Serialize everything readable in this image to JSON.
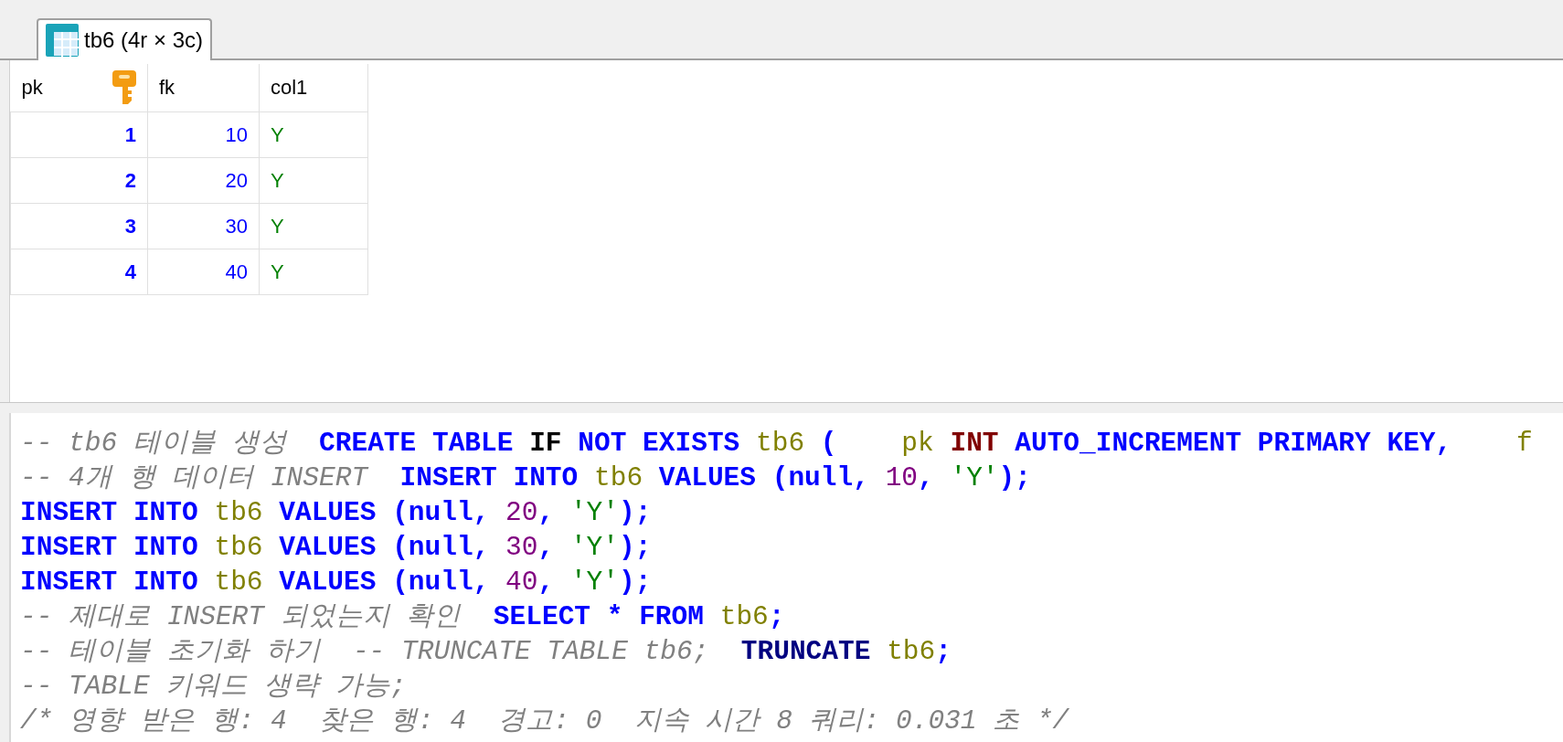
{
  "tabs": [
    {
      "label": "tb6 (4r × 3c)",
      "selected": true
    }
  ],
  "grid": {
    "columns": [
      {
        "name": "pk",
        "primary_key": true
      },
      {
        "name": "fk",
        "primary_key": false
      },
      {
        "name": "col1",
        "primary_key": false
      }
    ],
    "rows": [
      [
        "1",
        "10",
        "Y"
      ],
      [
        "2",
        "20",
        "Y"
      ],
      [
        "3",
        "30",
        "Y"
      ],
      [
        "4",
        "40",
        "Y"
      ]
    ]
  },
  "editor": {
    "lines": [
      [
        {
          "text": "-- tb6 테이블 생성  ",
          "kind": "comment"
        },
        {
          "text": "CREATE TABLE ",
          "kind": "keyword"
        },
        {
          "text": "IF",
          "kind": "plain"
        },
        {
          "text": " NOT EXISTS ",
          "kind": "keyword"
        },
        {
          "text": "tb6",
          "kind": "identifier"
        },
        {
          "text": " (    ",
          "kind": "keyword"
        },
        {
          "text": "pk ",
          "kind": "identifier"
        },
        {
          "text": "INT",
          "kind": "type"
        },
        {
          "text": " AUTO_INCREMENT PRIMARY KEY,    ",
          "kind": "keyword"
        },
        {
          "text": "f",
          "kind": "identifier"
        }
      ],
      [
        {
          "text": "-- 4개 행 데이터 INSERT  ",
          "kind": "comment"
        },
        {
          "text": "INSERT INTO ",
          "kind": "keyword"
        },
        {
          "text": "tb6",
          "kind": "identifier"
        },
        {
          "text": " VALUES (null, ",
          "kind": "keyword"
        },
        {
          "text": "10",
          "kind": "number"
        },
        {
          "text": ", ",
          "kind": "keyword"
        },
        {
          "text": "'Y'",
          "kind": "string"
        },
        {
          "text": ");",
          "kind": "keyword"
        }
      ],
      [
        {
          "text": "INSERT INTO ",
          "kind": "keyword"
        },
        {
          "text": "tb6",
          "kind": "identifier"
        },
        {
          "text": " VALUES (null, ",
          "kind": "keyword"
        },
        {
          "text": "20",
          "kind": "number"
        },
        {
          "text": ", ",
          "kind": "keyword"
        },
        {
          "text": "'Y'",
          "kind": "string"
        },
        {
          "text": ");",
          "kind": "keyword"
        }
      ],
      [
        {
          "text": "INSERT INTO ",
          "kind": "keyword"
        },
        {
          "text": "tb6",
          "kind": "identifier"
        },
        {
          "text": " VALUES (null, ",
          "kind": "keyword"
        },
        {
          "text": "30",
          "kind": "number"
        },
        {
          "text": ", ",
          "kind": "keyword"
        },
        {
          "text": "'Y'",
          "kind": "string"
        },
        {
          "text": ");",
          "kind": "keyword"
        }
      ],
      [
        {
          "text": "INSERT INTO ",
          "kind": "keyword"
        },
        {
          "text": "tb6",
          "kind": "identifier"
        },
        {
          "text": " VALUES (null, ",
          "kind": "keyword"
        },
        {
          "text": "40",
          "kind": "number"
        },
        {
          "text": ", ",
          "kind": "keyword"
        },
        {
          "text": "'Y'",
          "kind": "string"
        },
        {
          "text": ");",
          "kind": "keyword"
        }
      ],
      [
        {
          "text": "-- 제대로 INSERT 되었는지 확인  ",
          "kind": "comment"
        },
        {
          "text": "SELECT * FROM ",
          "kind": "keyword"
        },
        {
          "text": "tb6",
          "kind": "identifier"
        },
        {
          "text": ";",
          "kind": "keyword"
        }
      ],
      [
        {
          "text": "-- 테이블 초기화 하기  -- TRUNCATE TABLE tb6;  ",
          "kind": "comment"
        },
        {
          "text": "TRUNCATE ",
          "kind": "statement"
        },
        {
          "text": "tb6",
          "kind": "identifier"
        },
        {
          "text": ";",
          "kind": "keyword"
        }
      ],
      [
        {
          "text": "-- TABLE 키워드 생략 가능;",
          "kind": "comment"
        }
      ],
      [
        {
          "text": "/* 영향 받은 행: 4  찾은 행: 4  경고: 0  지속 시간 8 쿼리: 0.031 초 */",
          "kind": "comment"
        }
      ]
    ]
  }
}
